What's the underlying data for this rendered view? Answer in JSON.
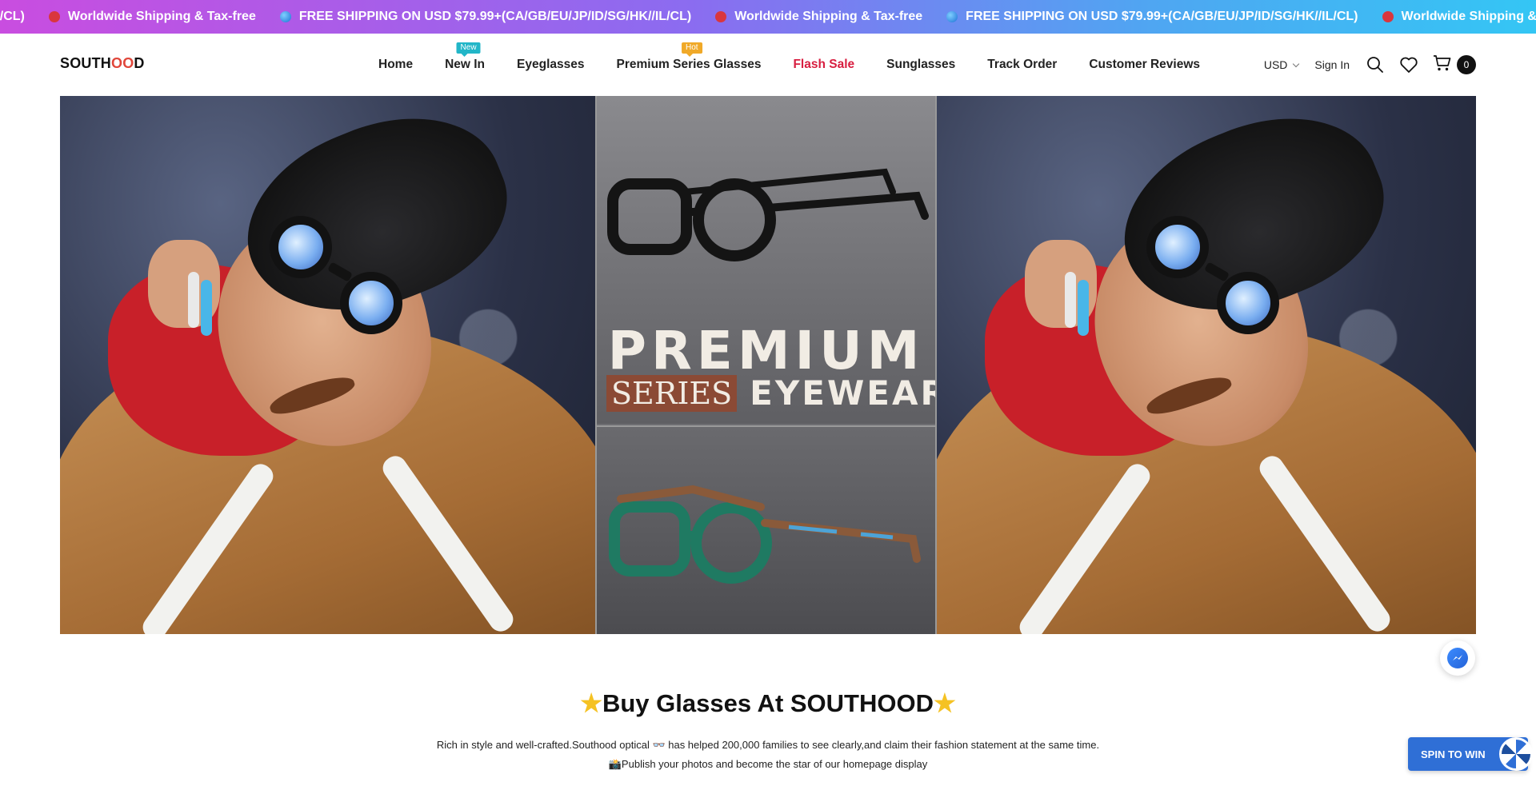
{
  "announcement": {
    "items": [
      {
        "icon": "hat-icon",
        "text": "L/CL)"
      },
      {
        "icon": "hat-icon",
        "text": "Worldwide Shipping & Tax-free"
      },
      {
        "icon": "globe-icon",
        "text": "FREE SHIPPING ON USD $79.99+(CA/GB/EU/JP/ID/SG/HK//IL/CL)"
      },
      {
        "icon": "hat-icon",
        "text": "Worldwide Shipping & Tax-free"
      },
      {
        "icon": "globe-icon",
        "text": "FREE SHIPPING ON USD $79.99+(CA/GB/EU/JP/ID/SG/HK//IL/CL)"
      },
      {
        "icon": "hat-icon",
        "text": "Worldwide Shipping & Tax-free"
      }
    ]
  },
  "header": {
    "logo": {
      "part1": "SOUTH",
      "part2": "OO",
      "part3": "D"
    },
    "nav": [
      {
        "label": "Home"
      },
      {
        "label": "New In",
        "badge": "New"
      },
      {
        "label": "Eyeglasses"
      },
      {
        "label": "Premium Series Glasses",
        "badge": "Hot"
      },
      {
        "label": "Flash Sale"
      },
      {
        "label": "Sunglasses"
      },
      {
        "label": "Track Order"
      },
      {
        "label": "Customer Reviews"
      }
    ],
    "currency": "USD",
    "sign_in": "Sign In",
    "cart_count": "0"
  },
  "hero": {
    "line1": "PREMIUM",
    "series": "SERIES",
    "eyewear": "EYEWEAR"
  },
  "intro": {
    "title": "Buy Glasses At SOUTHOOD",
    "line1": "Rich in style and well-crafted.Southood optical 👓 has helped 200,000 families to see clearly,and claim their fashion statement at the same time.",
    "line2": "📸Publish your photos and become the star of our homepage display"
  },
  "widgets": {
    "spin_label": "SPIN TO WIN"
  },
  "colors": {
    "flash_sale": "#d81e40",
    "badge_new": "#22b6c8",
    "badge_hot": "#f0a928",
    "spin_button": "#2f6fd6"
  }
}
